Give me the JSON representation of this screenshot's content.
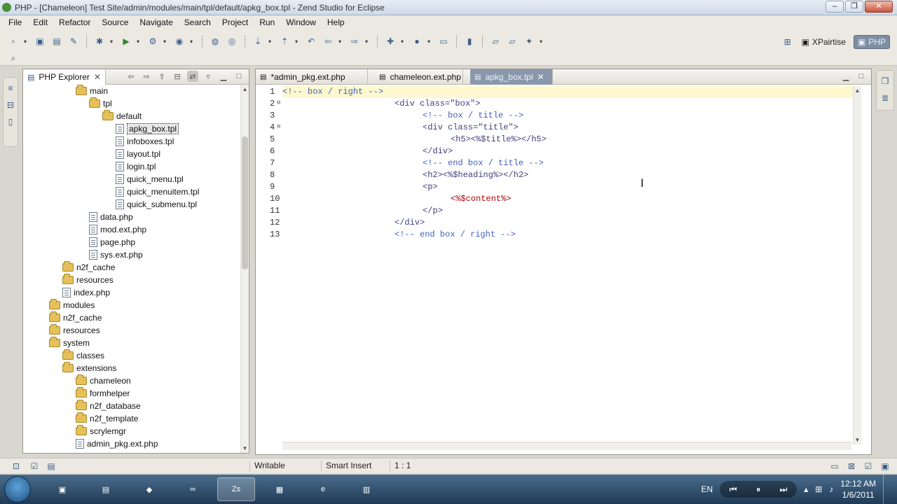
{
  "window": {
    "title": "PHP - [Chameleon] Test Site/admin/modules/main/tpl/default/apkg_box.tpl - Zend Studio for Eclipse"
  },
  "menubar": [
    "File",
    "Edit",
    "Refactor",
    "Source",
    "Navigate",
    "Search",
    "Project",
    "Run",
    "Window",
    "Help"
  ],
  "perspectives": [
    {
      "label": "XPairtise",
      "active": false
    },
    {
      "label": "PHP",
      "active": true
    }
  ],
  "explorer": {
    "tab_label": "PHP Explorer",
    "tree": [
      {
        "label": "main",
        "type": "folder",
        "depth": 4
      },
      {
        "label": "tpl",
        "type": "folder",
        "depth": 5
      },
      {
        "label": "default",
        "type": "folder",
        "depth": 6
      },
      {
        "label": "apkg_box.tpl",
        "type": "file",
        "depth": 7,
        "selected": true
      },
      {
        "label": "infoboxes.tpl",
        "type": "file",
        "depth": 7
      },
      {
        "label": "layout.tpl",
        "type": "file",
        "depth": 7
      },
      {
        "label": "login.tpl",
        "type": "file",
        "depth": 7
      },
      {
        "label": "quick_menu.tpl",
        "type": "file",
        "depth": 7
      },
      {
        "label": "quick_menuitem.tpl",
        "type": "file",
        "depth": 7
      },
      {
        "label": "quick_submenu.tpl",
        "type": "file",
        "depth": 7
      },
      {
        "label": "data.php",
        "type": "file",
        "depth": 5
      },
      {
        "label": "mod.ext.php",
        "type": "file",
        "depth": 5
      },
      {
        "label": "page.php",
        "type": "file",
        "depth": 5
      },
      {
        "label": "sys.ext.php",
        "type": "file",
        "depth": 5
      },
      {
        "label": "n2f_cache",
        "type": "folder",
        "depth": 3
      },
      {
        "label": "resources",
        "type": "folder",
        "depth": 3
      },
      {
        "label": "index.php",
        "type": "file",
        "depth": 3
      },
      {
        "label": "modules",
        "type": "folder",
        "depth": 2
      },
      {
        "label": "n2f_cache",
        "type": "folder",
        "depth": 2
      },
      {
        "label": "resources",
        "type": "folder",
        "depth": 2
      },
      {
        "label": "system",
        "type": "folder",
        "depth": 2
      },
      {
        "label": "classes",
        "type": "folder",
        "depth": 3
      },
      {
        "label": "extensions",
        "type": "folder",
        "depth": 3
      },
      {
        "label": "chameleon",
        "type": "folder",
        "depth": 4
      },
      {
        "label": "formhelper",
        "type": "folder",
        "depth": 4
      },
      {
        "label": "n2f_database",
        "type": "folder",
        "depth": 4
      },
      {
        "label": "n2f_template",
        "type": "folder",
        "depth": 4
      },
      {
        "label": "scrylemgr",
        "type": "folder",
        "depth": 4
      },
      {
        "label": "admin_pkg.ext.php",
        "type": "file",
        "depth": 4
      }
    ]
  },
  "editor": {
    "tabs": [
      {
        "label": "*admin_pkg.ext.php",
        "active": false
      },
      {
        "label": "chameleon.ext.php",
        "active": false
      },
      {
        "label": "apkg_box.tpl",
        "active": true
      }
    ],
    "lines": [
      {
        "num": "1",
        "fold": false,
        "indent": 0,
        "text": "<!-- box / right -->"
      },
      {
        "num": "2",
        "fold": true,
        "indent": 20,
        "text": "<div class=\"box\">"
      },
      {
        "num": "3",
        "fold": false,
        "indent": 25,
        "text": "<!-- box / title -->"
      },
      {
        "num": "4",
        "fold": true,
        "indent": 25,
        "text": "<div class=\"title\">"
      },
      {
        "num": "5",
        "fold": false,
        "indent": 30,
        "text": "<h5><%$title%></h5>"
      },
      {
        "num": "6",
        "fold": false,
        "indent": 25,
        "text": "</div>"
      },
      {
        "num": "7",
        "fold": false,
        "indent": 25,
        "text": "<!-- end box / title -->"
      },
      {
        "num": "8",
        "fold": false,
        "indent": 25,
        "text": "<h2><%$heading%></h2>"
      },
      {
        "num": "9",
        "fold": false,
        "indent": 25,
        "text": "<p>"
      },
      {
        "num": "10",
        "fold": false,
        "indent": 30,
        "text": "<%$content%>"
      },
      {
        "num": "11",
        "fold": false,
        "indent": 25,
        "text": "</p>"
      },
      {
        "num": "12",
        "fold": false,
        "indent": 20,
        "text": "</div>"
      },
      {
        "num": "13",
        "fold": false,
        "indent": 20,
        "text": "<!-- end box / right -->"
      }
    ]
  },
  "statusbar": {
    "mode": "Writable",
    "insert": "Smart Insert",
    "position": "1 : 1"
  },
  "taskbar": {
    "language": "EN",
    "time": "12:12 AM",
    "date": "1/6/2011"
  },
  "colors": {
    "active_tab": "#8a98ab",
    "current_line": "#fdf8d0",
    "folder": "#e6c05a"
  }
}
